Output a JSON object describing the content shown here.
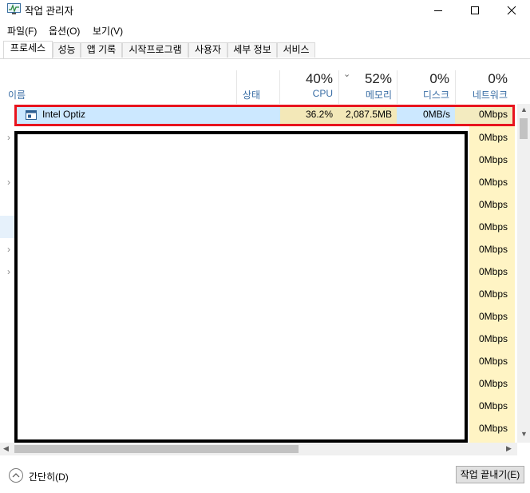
{
  "window": {
    "title": "작업 관리자"
  },
  "menu": [
    "파일(F)",
    "옵션(O)",
    "보기(V)"
  ],
  "tabs": [
    "프로세스",
    "성능",
    "앱 기록",
    "시작프로그램",
    "사용자",
    "세부 정보",
    "서비스"
  ],
  "header": {
    "name_label": "이름",
    "status_label": "상태",
    "cpu": {
      "pct": "40%",
      "label": "CPU"
    },
    "memory": {
      "pct": "52%",
      "label": "메모리"
    },
    "disk": {
      "pct": "0%",
      "label": "디스크"
    },
    "network": {
      "pct": "0%",
      "label": "네트워크"
    }
  },
  "selected_row": {
    "name": "Intel Optiz",
    "cpu": "36.2%",
    "memory": "2,087.5MB",
    "disk": "0MB/s",
    "network": "0Mbps"
  },
  "network_values": [
    "0Mbps",
    "0Mbps",
    "0Mbps",
    "0Mbps",
    "0Mbps",
    "0Mbps",
    "0Mbps",
    "0Mbps",
    "0Mbps",
    "0Mbps",
    "0Mbps",
    "0Mbps",
    "0Mbps",
    "0Mbps"
  ],
  "footer": {
    "fewer_details": "간단히(D)",
    "end_task": "작업 끝내기(E)"
  },
  "colors": {
    "selection": "#cce8ff",
    "highlight_border": "#e8141e",
    "heat_yellow": "#fff4c4"
  }
}
